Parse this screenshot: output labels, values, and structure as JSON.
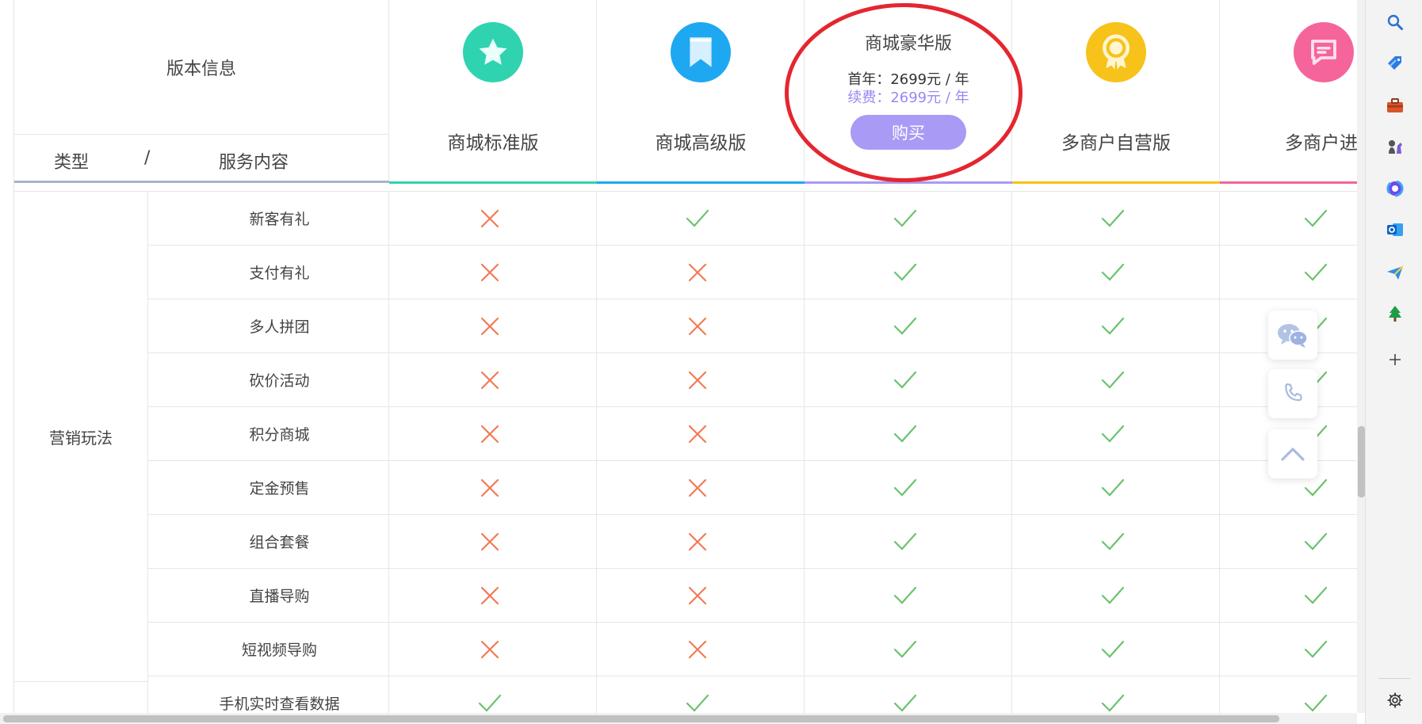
{
  "header": {
    "version_label": "版本信息",
    "type_label": "类型",
    "slash": "/",
    "service_label": "服务内容"
  },
  "plans": [
    {
      "name": "商城标准版",
      "color": "#2fd3b0",
      "icon": "star-icon"
    },
    {
      "name": "商城高级版",
      "color": "#1ea8f2",
      "icon": "bookmark-icon"
    },
    {
      "name": "商城豪华版",
      "color": "#a99af5",
      "first_year": "首年：2699元 / 年",
      "renewal": "续费：2699元 / 年",
      "buy_label": "购买"
    },
    {
      "name": "多商户自营版",
      "color": "#f7c21a",
      "icon": "award-icon"
    },
    {
      "name": "多商户进驻",
      "color": "#f5649a",
      "icon": "chat-bubble-icon"
    }
  ],
  "category": "营销玩法",
  "rows": [
    {
      "service": "新客有礼",
      "values": [
        false,
        true,
        true,
        true,
        true
      ]
    },
    {
      "service": "支付有礼",
      "values": [
        false,
        false,
        true,
        true,
        true
      ]
    },
    {
      "service": "多人拼团",
      "values": [
        false,
        false,
        true,
        true,
        true
      ]
    },
    {
      "service": "砍价活动",
      "values": [
        false,
        false,
        true,
        true,
        true
      ]
    },
    {
      "service": "积分商城",
      "values": [
        false,
        false,
        true,
        true,
        true
      ]
    },
    {
      "service": "定金预售",
      "values": [
        false,
        false,
        true,
        true,
        true
      ]
    },
    {
      "service": "组合套餐",
      "values": [
        false,
        false,
        true,
        true,
        true
      ]
    },
    {
      "service": "直播导购",
      "values": [
        false,
        false,
        true,
        true,
        true
      ]
    },
    {
      "service": "短视频导购",
      "values": [
        false,
        false,
        true,
        true,
        true
      ]
    },
    {
      "service": "手机实时查看数据",
      "values": [
        true,
        true,
        true,
        true,
        true
      ]
    }
  ],
  "colors": {
    "check": "#6cc26f",
    "cross": "#f27a55",
    "accent": "#a99af5",
    "highlight": "#e4262f"
  },
  "float_buttons": [
    "wechat-icon",
    "phone-icon",
    "back-to-top-icon"
  ],
  "sidebar_icons": [
    "search-icon",
    "tag-icon",
    "toolbox-icon",
    "chess-icon",
    "copilot-icon",
    "outlook-icon",
    "send-icon",
    "tree-icon",
    "add-icon",
    "settings-icon"
  ]
}
